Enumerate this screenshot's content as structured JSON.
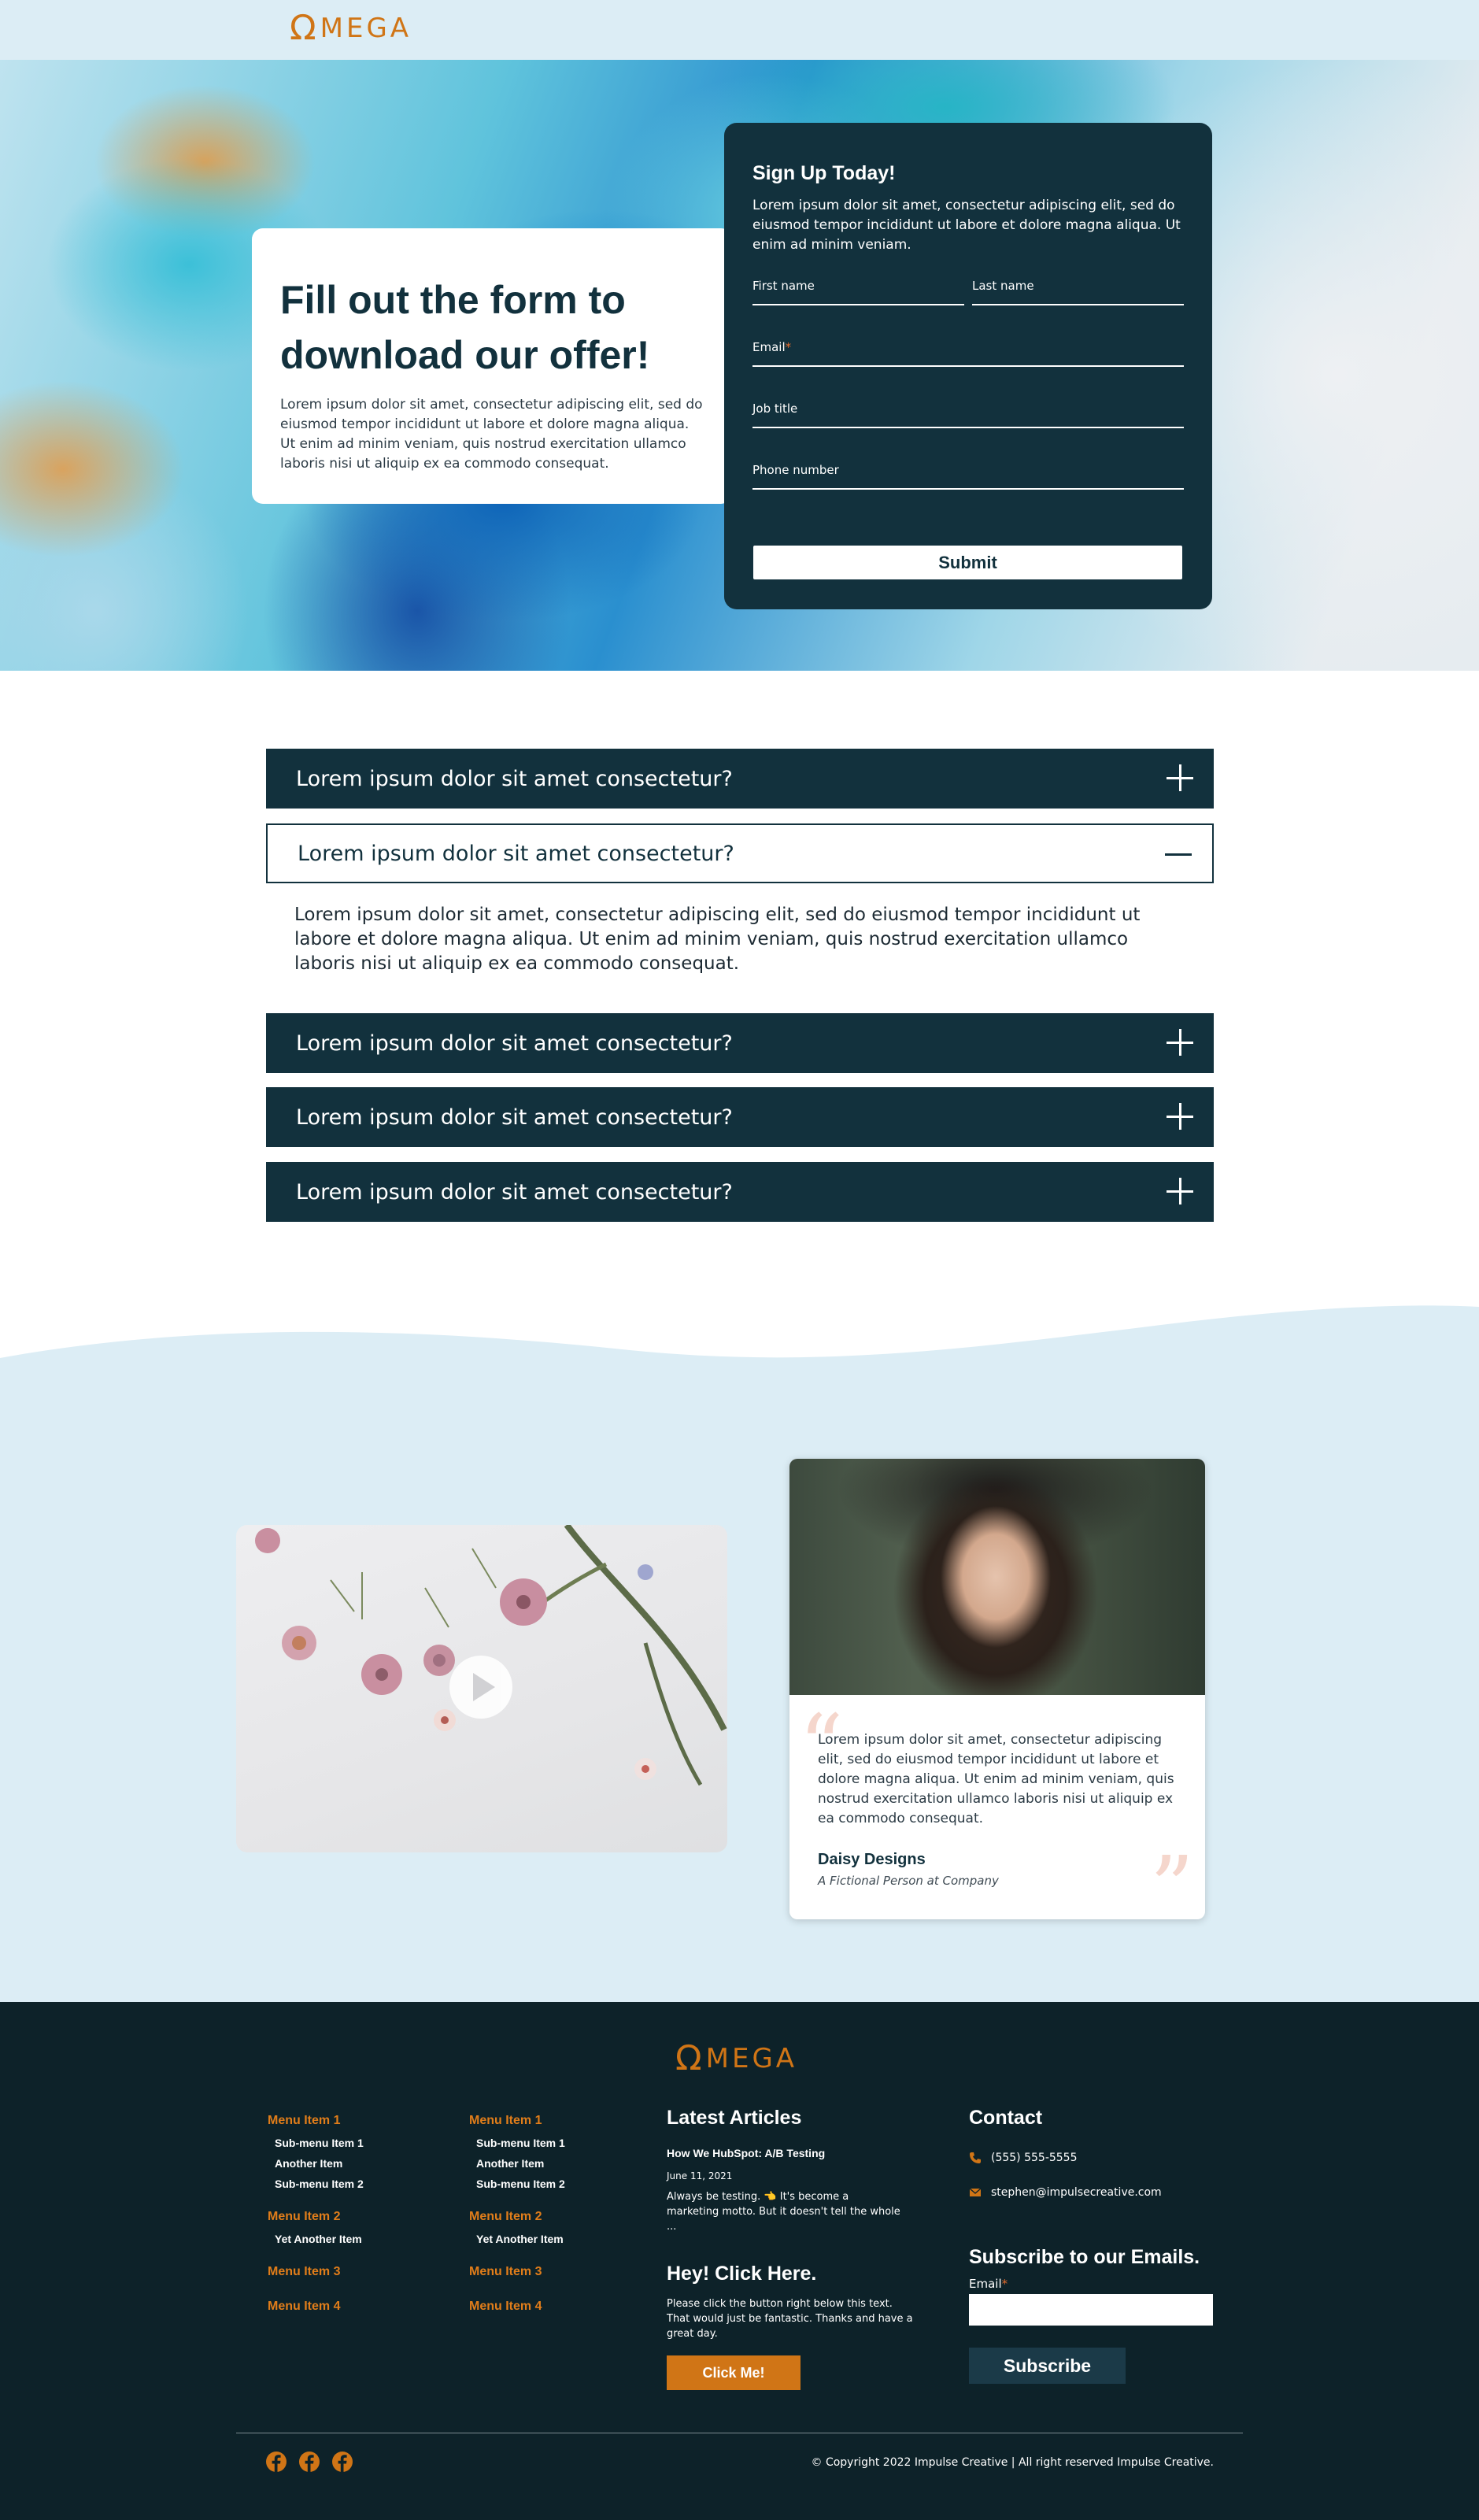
{
  "brand": {
    "logo_text": "MEGA",
    "logo_symbol": "Ω",
    "accent": "#d07516",
    "dark": "#12313d",
    "footer_bg": "#0d2229",
    "light_bg": "#dcedf5"
  },
  "hero": {
    "title": "Fill out the form to download our offer!",
    "text": "Lorem ipsum dolor sit amet, consectetur adipiscing elit, sed do eiusmod tempor incididunt ut labore et dolore magna aliqua. Ut enim ad minim veniam, quis nostrud exercitation ullamco laboris nisi ut aliquip ex ea commodo consequat."
  },
  "signup": {
    "title": "Sign Up Today!",
    "text": "Lorem ipsum dolor sit amet, consectetur adipiscing elit, sed do eiusmod tempor incididunt ut labore et dolore magna aliqua. Ut enim ad minim veniam.",
    "first_name": "First name",
    "last_name": "Last name",
    "email": "Email",
    "required_mark": "*",
    "job_title": "Job title",
    "phone": "Phone number",
    "submit": "Submit"
  },
  "faq": {
    "items": [
      {
        "question": "Lorem ipsum dolor sit amet consectetur?",
        "open": false
      },
      {
        "question": "Lorem ipsum dolor sit amet consectetur?",
        "open": true,
        "answer": "Lorem ipsum dolor sit amet, consectetur adipiscing elit, sed do eiusmod tempor incididunt ut labore et dolore magna aliqua. Ut enim ad minim veniam, quis nostrud exercitation ullamco laboris nisi ut aliquip ex ea commodo consequat."
      },
      {
        "question": "Lorem ipsum dolor sit amet consectetur?",
        "open": false
      },
      {
        "question": "Lorem ipsum dolor sit amet consectetur?",
        "open": false
      },
      {
        "question": "Lorem ipsum dolor sit amet consectetur?",
        "open": false
      }
    ]
  },
  "testimonial": {
    "quote": "Lorem ipsum dolor sit amet, consectetur adipiscing elit, sed do eiusmod tempor incididunt ut labore et dolore magna aliqua. Ut enim ad minim veniam, quis nostrud exercitation ullamco laboris nisi ut aliquip ex ea commodo consequat.",
    "name": "Daisy Designs",
    "role": "A Fictional Person at Company"
  },
  "footer": {
    "menus": [
      {
        "groups": [
          {
            "label": "Menu Item 1",
            "subs": [
              "Sub-menu Item 1",
              "Another Item",
              "Sub-menu Item 2"
            ]
          },
          {
            "label": "Menu Item 2",
            "subs": [
              "Yet Another Item"
            ]
          },
          {
            "label": "Menu Item 3",
            "subs": []
          },
          {
            "label": "Menu Item 4",
            "subs": []
          }
        ]
      },
      {
        "groups": [
          {
            "label": "Menu Item 1",
            "subs": [
              "Sub-menu Item 1",
              "Another Item",
              "Sub-menu Item 2"
            ]
          },
          {
            "label": "Menu Item 2",
            "subs": [
              "Yet Another Item"
            ]
          },
          {
            "label": "Menu Item 3",
            "subs": []
          },
          {
            "label": "Menu Item 4",
            "subs": []
          }
        ]
      }
    ],
    "articles": {
      "heading": "Latest Articles",
      "title": "How We HubSpot: A/B Testing",
      "date": "June 11, 2021",
      "excerpt": "Always be testing. 👈 It's become a marketing motto. But it doesn't tell the whole ..."
    },
    "cta": {
      "heading": "Hey! Click Here.",
      "text": "Please click the button right below this text. That would just be fantastic. Thanks and have a great day.",
      "button": "Click Me!"
    },
    "contact": {
      "heading": "Contact",
      "phone": "(555) 555-5555",
      "email": "stephen@impulsecreative.com"
    },
    "newsletter": {
      "heading": "Subscribe to our Emails.",
      "email_label": "Email",
      "required_mark": "*",
      "button": "Subscribe"
    },
    "social_icons": [
      "facebook-icon",
      "facebook-icon",
      "facebook-icon"
    ],
    "copyright": "© Copyright 2022 Impulse Creative | All right reserved Impulse Creative."
  }
}
